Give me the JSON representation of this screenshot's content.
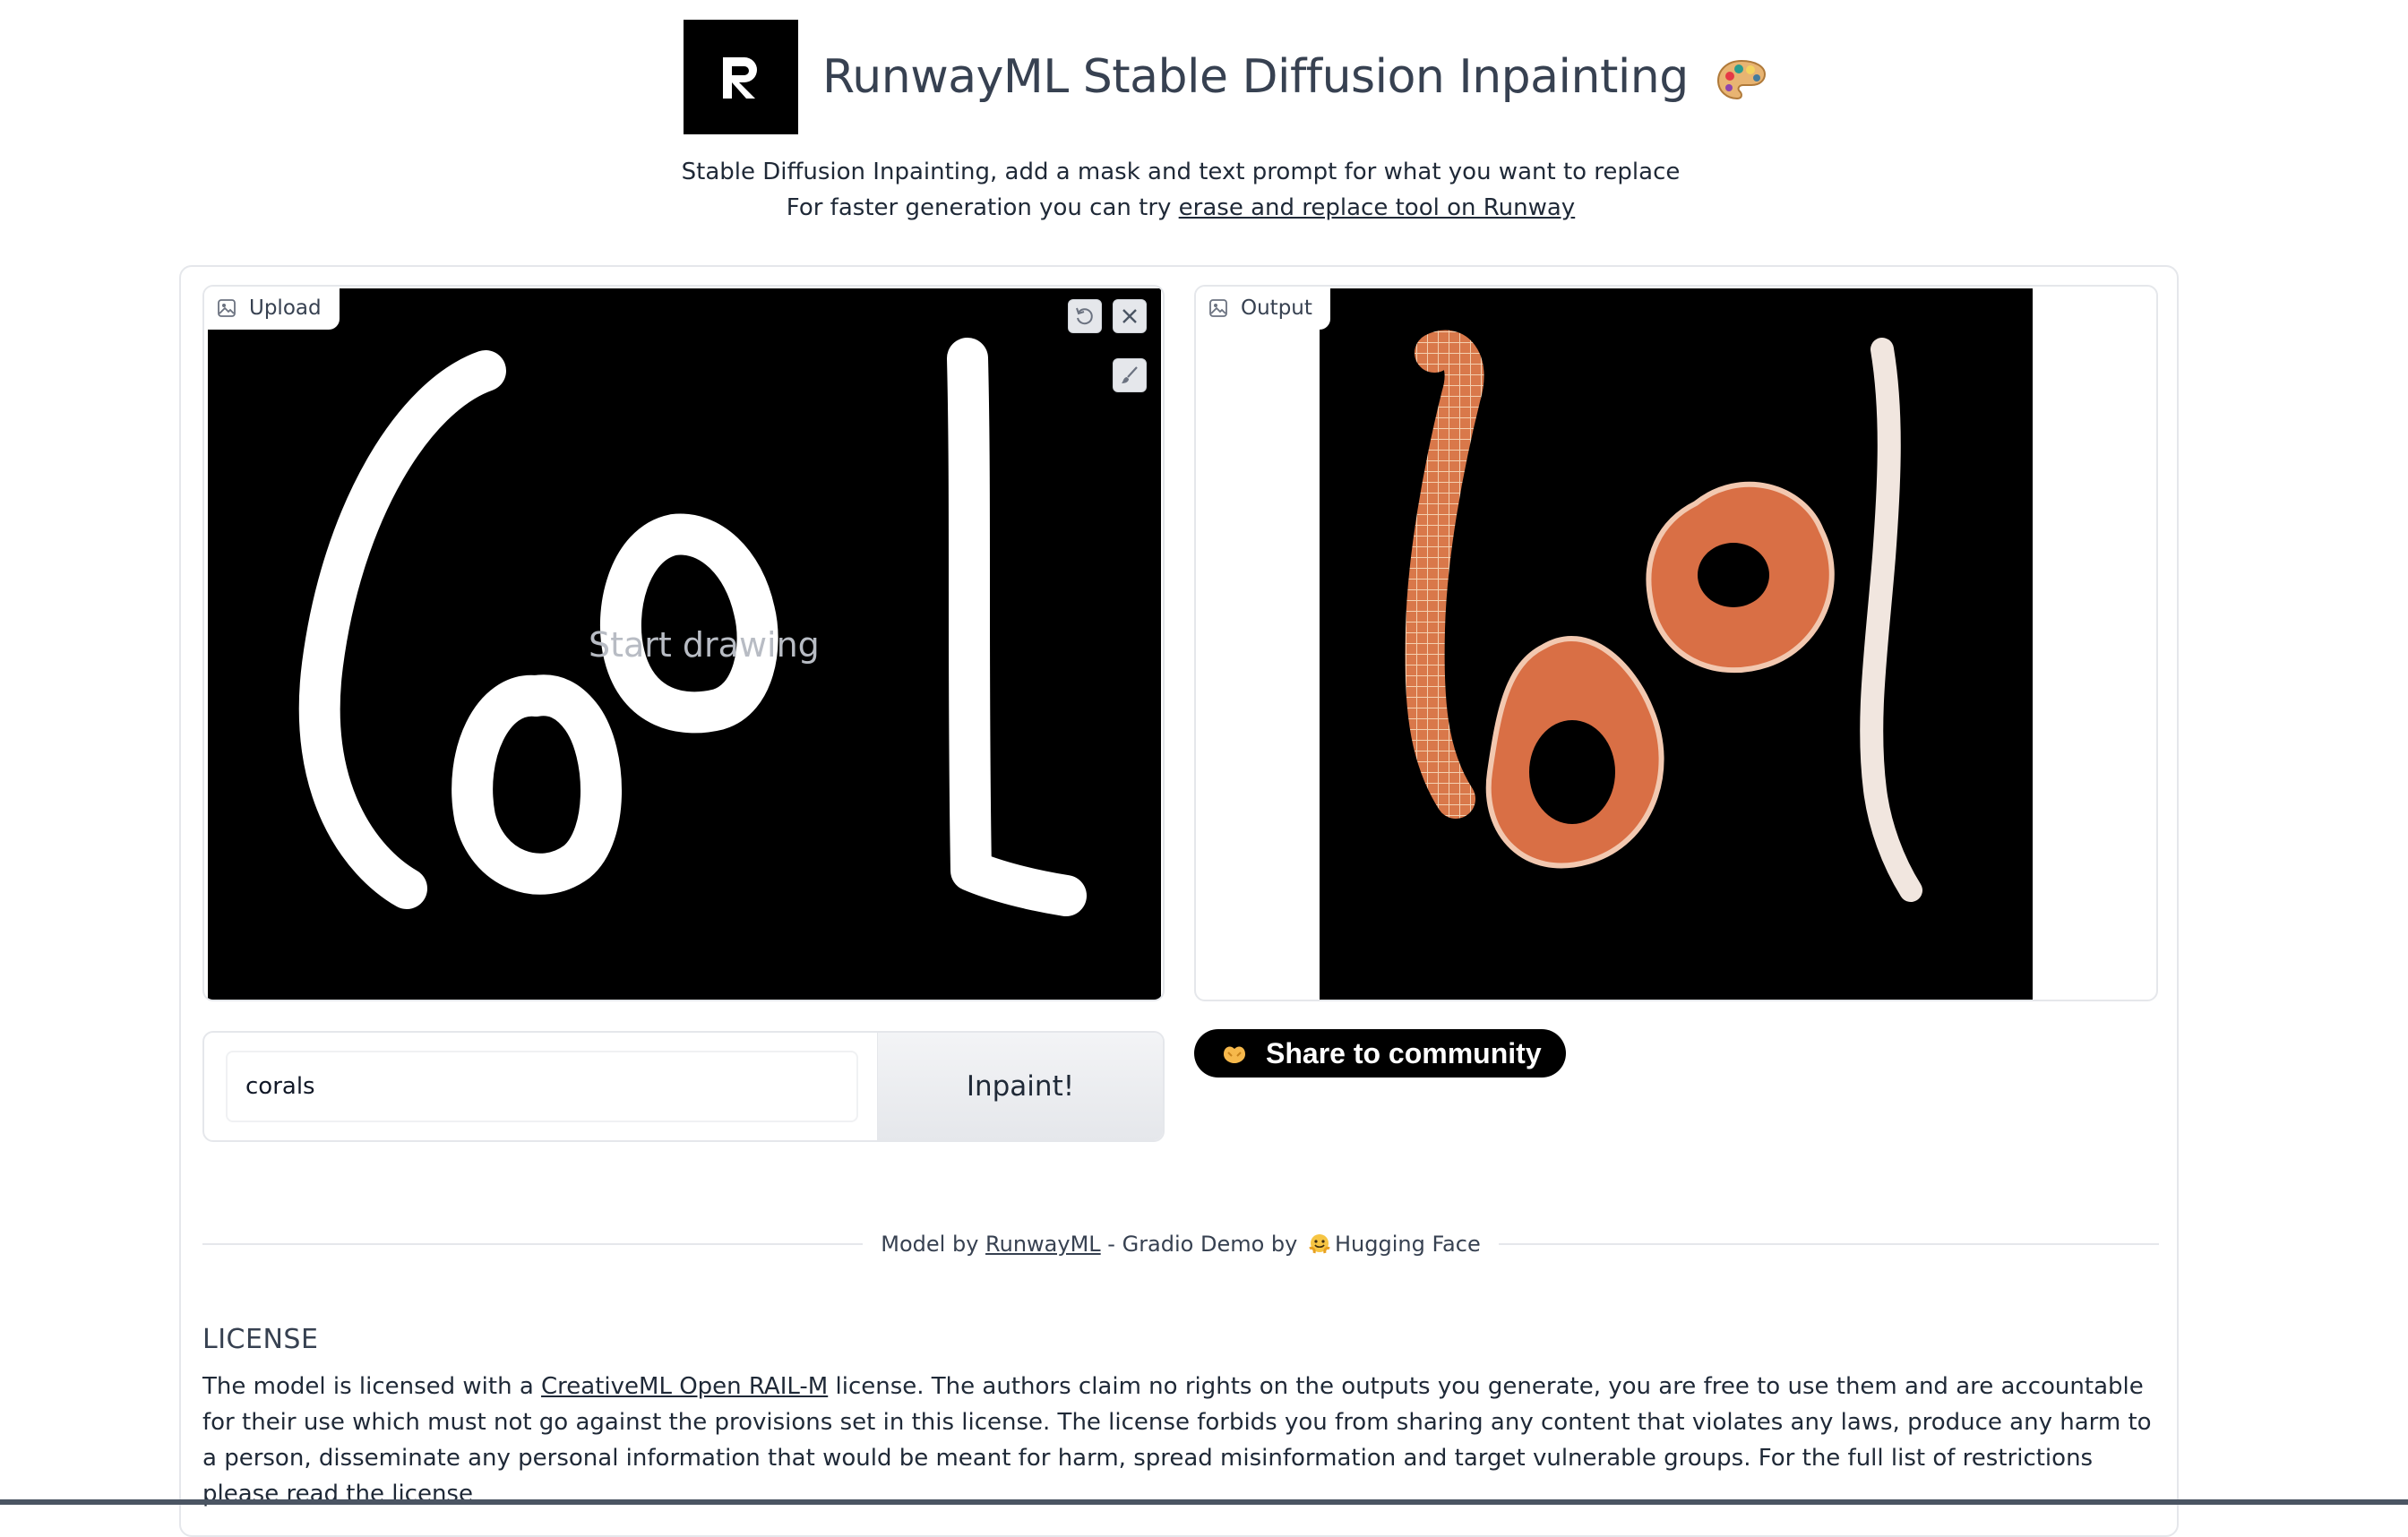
{
  "header": {
    "title": "RunwayML Stable Diffusion Inpainting",
    "subtitle_line1": "Stable Diffusion Inpainting, add a mask and text prompt for what you want to replace",
    "subtitle_line2_prefix": "For faster generation you can try ",
    "subtitle_link": "erase and replace tool on Runway"
  },
  "upload": {
    "label": "Upload",
    "canvas_hint": "Start drawing"
  },
  "output": {
    "label": "Output"
  },
  "prompt": {
    "value": "corals",
    "button_label": "Inpaint!"
  },
  "share": {
    "label": "Share to community"
  },
  "footer": {
    "prefix": "Model by ",
    "runway_link": "RunwayML",
    "middle": " - Gradio Demo by ",
    "suffix": "Hugging Face"
  },
  "license": {
    "title": "LICENSE",
    "text_before": "The model is licensed with a ",
    "link1": "CreativeML Open RAIL-M",
    "text_middle": " license. The authors claim no rights on the outputs you generate, you are free to use them and are accountable for their use which must not go against the provisions set in this license. The license forbids you from sharing any content that violates any laws, produce any harm to a person, disseminate any personal information that would be meant for harm, spread misinformation and target vulnerable groups. For the full list of restrictions please ",
    "link2": "read the license"
  },
  "colors": {
    "accent_dark": "#000000",
    "border": "#e5e7eb",
    "coral": "#d9784a"
  },
  "icons": [
    "runway-logo-icon",
    "palette-icon",
    "image-icon",
    "undo-icon",
    "close-icon",
    "brush-icon",
    "hugging-hands-icon",
    "hugging-face-icon"
  ]
}
